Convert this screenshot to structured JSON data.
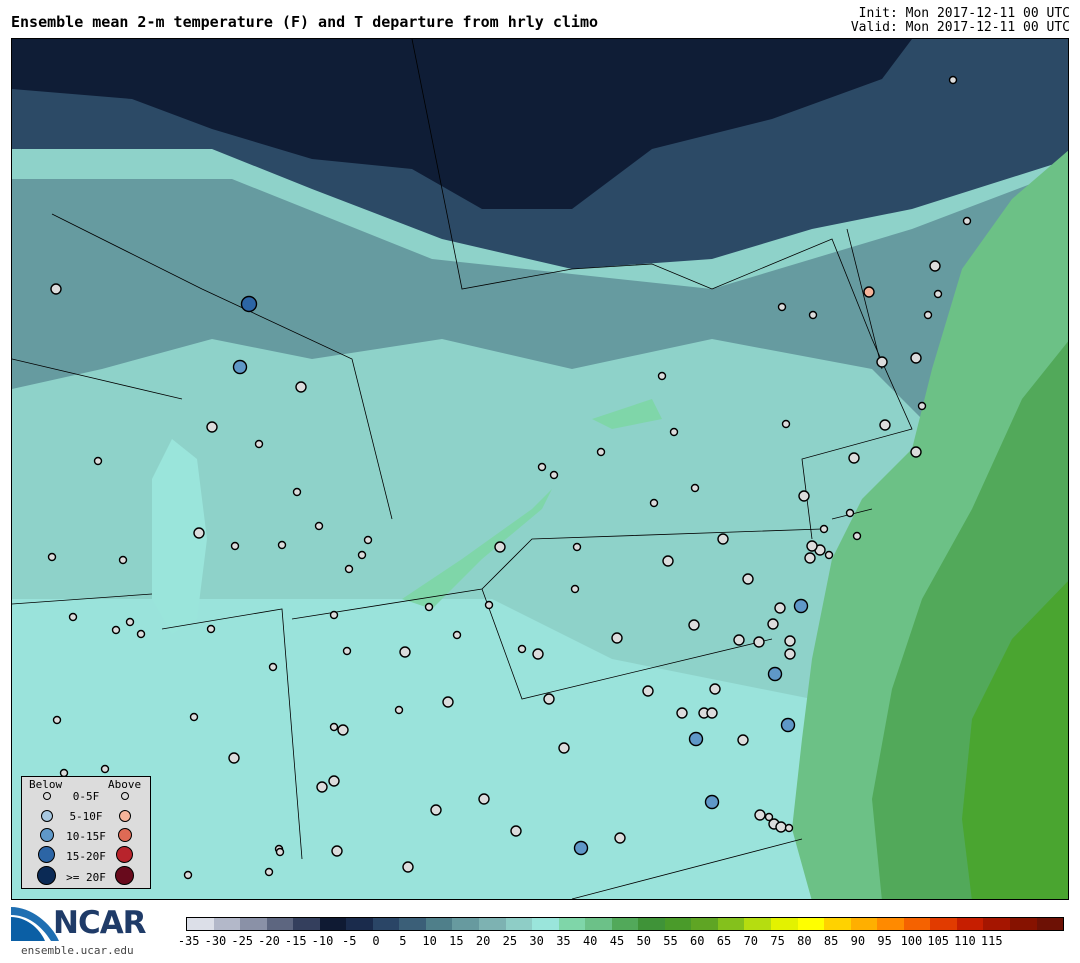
{
  "header": {
    "title": "Ensemble mean 2-m temperature (F) and T departure from hrly climo",
    "init": "Init: Mon 2017-12-11 00 UTC",
    "valid": "Valid: Mon 2017-12-11 00 UTC"
  },
  "legend": {
    "below_label": "Below",
    "above_label": "Above",
    "rows": [
      {
        "label": "0-5F",
        "below_color": "#dcdcdc",
        "above_color": "#dcdcdc"
      },
      {
        "label": "5-10F",
        "below_color": "#a8c8e0",
        "above_color": "#f5b49a"
      },
      {
        "label": "10-15F",
        "below_color": "#5f98c8",
        "above_color": "#de6a55"
      },
      {
        "label": "15-20F",
        "below_color": "#2c65a5",
        "above_color": "#b8242c"
      },
      {
        "label": ">= 20F",
        "below_color": "#0b2a55",
        "above_color": "#680a1c"
      }
    ]
  },
  "colorbar": {
    "colors": [
      "#dcdfe8",
      "#b3b8c9",
      "#8a91a7",
      "#5d6680",
      "#343f5d",
      "#0f1a33",
      "#1a2b4c",
      "#2a4566",
      "#3b5f78",
      "#4f7f8a",
      "#679a9f",
      "#7db2b2",
      "#8ecdc6",
      "#9ae5db",
      "#7fd6a9",
      "#6cc188",
      "#52a95a",
      "#3f9338",
      "#4a9b2a",
      "#5fa524",
      "#84c11c",
      "#b5dd10",
      "#e3f200",
      "#ffff00",
      "#ffd200",
      "#ffaf00",
      "#ff8a00",
      "#f56200",
      "#e13b00",
      "#c61e00",
      "#a51500",
      "#861200",
      "#6d1105"
    ],
    "tick_labels": [
      "-35",
      "-30",
      "-25",
      "-20",
      "-15",
      "-10",
      "-5",
      "0",
      "5",
      "10",
      "15",
      "20",
      "25",
      "30",
      "35",
      "40",
      "45",
      "50",
      "55",
      "60",
      "65",
      "70",
      "75",
      "80",
      "85",
      "90",
      "95",
      "100",
      "105",
      "110",
      "115"
    ]
  },
  "logo": {
    "name": "NCAR",
    "url": "ensemble.ucar.edu"
  },
  "map": {
    "background_zones": [
      {
        "name": "canada-deep",
        "color": "#0f1d36"
      },
      {
        "name": "canada-mid",
        "color": "#2c4a66"
      },
      {
        "name": "great-lakes",
        "color": "#669ba0"
      },
      {
        "name": "interior",
        "color": "#8ed2c9"
      },
      {
        "name": "south",
        "color": "#9ae3db"
      },
      {
        "name": "coast-warm",
        "color": "#6cc186"
      },
      {
        "name": "ocean-warm",
        "color": "#52a95a"
      },
      {
        "name": "ocean-hot",
        "color": "#4aa530"
      }
    ],
    "stations": [
      {
        "category": 3,
        "side": "below"
      },
      {
        "category": 2,
        "side": "below"
      },
      {
        "category": 1,
        "side": "above"
      }
    ]
  }
}
